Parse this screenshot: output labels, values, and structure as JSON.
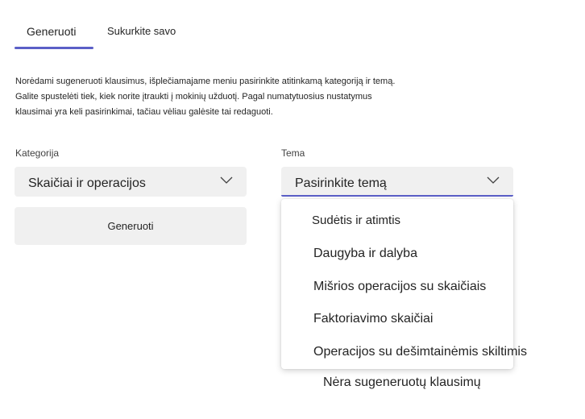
{
  "tabs": {
    "generate_label": "Generuoti",
    "create_label": "Sukurkite savo",
    "active_color": "#5b5fc7"
  },
  "intro": {
    "line1": "Norėdami sugeneruoti klausimus, išplečiamajame meniu pasirinkite atitinkamą kategoriją ir temą.",
    "line2": "Galite spustelėti tiek, kiek norite įtraukti į mokinių užduotį. Pagal numatytuosius nustatymus",
    "line3": "klausimai yra keli pasirinkimai, tačiau vėliau galėsite tai redaguoti."
  },
  "category": {
    "label": "Kategorija",
    "value": "Skaičiai ir operacijos",
    "icon": "chevron-down-icon"
  },
  "topic": {
    "label": "Tema",
    "value": "Pasirinkite temą",
    "icon": "chevron-down-icon",
    "options": [
      "Sudėtis ir atimtis",
      "Daugyba ir dalyba",
      "Mišrios operacijos su skaičiais",
      "Faktoriavimo skaičiai",
      "Operacijos su dešimtainėmis skiltimis"
    ]
  },
  "generate_button": {
    "label": "Generuoti"
  },
  "empty_state": {
    "message": "Nėra sugeneruotų klausimų"
  }
}
